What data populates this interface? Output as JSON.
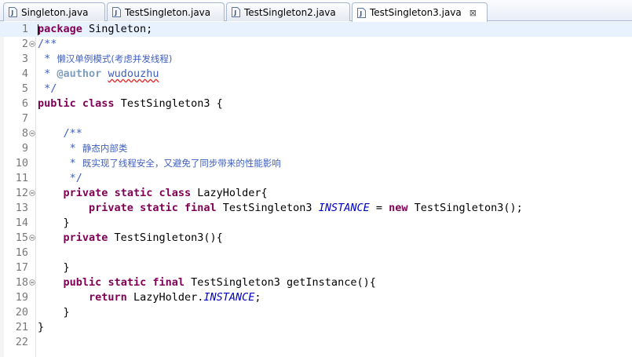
{
  "tabs": [
    {
      "label": "Singleton.java",
      "active": false
    },
    {
      "label": "TestSingleton.java",
      "active": false
    },
    {
      "label": "TestSingleton2.java",
      "active": false
    },
    {
      "label": "TestSingleton3.java",
      "active": true
    }
  ],
  "close_glyph": "⊠",
  "colors": {
    "keyword": "#7f0055",
    "javadoc": "#3f5fbf",
    "javadoc_tag": "#7f9fbf",
    "static_field": "#0000c0",
    "line_number": "#787878",
    "current_line": "#e8f2fe"
  },
  "editor": {
    "current_line": 1,
    "folded_lines": [
      2,
      8,
      12,
      15,
      18
    ],
    "lines": [
      [
        {
          "t": "package",
          "s": "kw"
        },
        {
          "t": " Singleton;"
        }
      ],
      [
        {
          "t": "/**",
          "s": "jd"
        }
      ],
      [
        {
          "t": " * ",
          "s": "jd"
        },
        {
          "t": "懒汉单例模式(考虑并发线程)",
          "s": "jd cjk"
        }
      ],
      [
        {
          "t": " * ",
          "s": "jd"
        },
        {
          "t": "@author",
          "s": "tag"
        },
        {
          "t": " ",
          "s": "jd"
        },
        {
          "t": "wudouzhu",
          "s": "jd sq"
        }
      ],
      [
        {
          "t": " */",
          "s": "jd"
        }
      ],
      [
        {
          "t": "public",
          "s": "kw"
        },
        {
          "t": " "
        },
        {
          "t": "class",
          "s": "kw"
        },
        {
          "t": " TestSingleton3 {"
        }
      ],
      [],
      [
        {
          "t": "    "
        },
        {
          "t": "/**",
          "s": "jd"
        }
      ],
      [
        {
          "t": "     * ",
          "s": "jd"
        },
        {
          "t": "静态内部类",
          "s": "jd cjk"
        }
      ],
      [
        {
          "t": "     * ",
          "s": "jd"
        },
        {
          "t": "既实现了线程安全，又避免了同步带来的性能影响",
          "s": "jd cjk"
        }
      ],
      [
        {
          "t": "     */",
          "s": "jd"
        }
      ],
      [
        {
          "t": "    "
        },
        {
          "t": "private",
          "s": "kw"
        },
        {
          "t": " "
        },
        {
          "t": "static",
          "s": "kw"
        },
        {
          "t": " "
        },
        {
          "t": "class",
          "s": "kw"
        },
        {
          "t": " LazyHolder{"
        }
      ],
      [
        {
          "t": "        "
        },
        {
          "t": "private",
          "s": "kw"
        },
        {
          "t": " "
        },
        {
          "t": "static",
          "s": "kw"
        },
        {
          "t": " "
        },
        {
          "t": "final",
          "s": "kw"
        },
        {
          "t": " TestSingleton3 "
        },
        {
          "t": "INSTANCE",
          "s": "inst"
        },
        {
          "t": " = "
        },
        {
          "t": "new",
          "s": "kw"
        },
        {
          "t": " TestSingleton3();"
        }
      ],
      [
        {
          "t": "    }"
        }
      ],
      [
        {
          "t": "    "
        },
        {
          "t": "private",
          "s": "kw"
        },
        {
          "t": " TestSingleton3(){"
        }
      ],
      [],
      [
        {
          "t": "    }"
        }
      ],
      [
        {
          "t": "    "
        },
        {
          "t": "public",
          "s": "kw"
        },
        {
          "t": " "
        },
        {
          "t": "static",
          "s": "kw"
        },
        {
          "t": " "
        },
        {
          "t": "final",
          "s": "kw"
        },
        {
          "t": " TestSingleton3 getInstance(){"
        }
      ],
      [
        {
          "t": "        "
        },
        {
          "t": "return",
          "s": "kw"
        },
        {
          "t": " LazyHolder."
        },
        {
          "t": "INSTANCE",
          "s": "inst"
        },
        {
          "t": ";"
        }
      ],
      [
        {
          "t": "    }"
        }
      ],
      [
        {
          "t": "}"
        }
      ],
      []
    ]
  }
}
